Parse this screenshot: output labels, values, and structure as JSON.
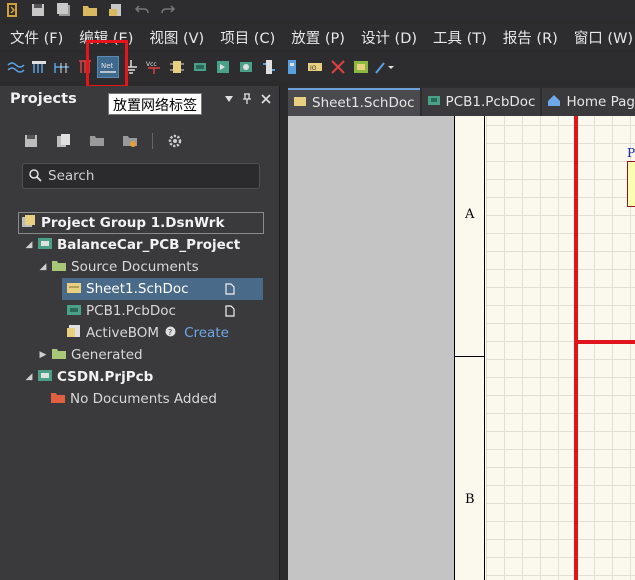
{
  "menu": [
    "文件 (F)",
    "编辑 (E)",
    "视图 (V)",
    "项目 (C)",
    "放置 (P)",
    "设计 (D)",
    "工具 (T)",
    "报告 (R)",
    "窗口 (W)"
  ],
  "tooltip": "放置网络标签",
  "panel": {
    "title": "Projects",
    "search_placeholder": "Search"
  },
  "tree": {
    "group": "Project Group 1.DsnWrk",
    "project1": "BalanceCar_PCB_Project",
    "source_folder": "Source Documents",
    "sheet": "Sheet1.SchDoc",
    "pcb": "PCB1.PcbDoc",
    "bom": "ActiveBOM",
    "bom_action": "Create",
    "generated": "Generated",
    "project2": "CSDN.PrjPcb",
    "no_docs": "No Documents Added"
  },
  "tabs": [
    "Sheet1.SchDoc",
    "PCB1.PcbDoc",
    "Home Page"
  ],
  "sheet": {
    "zone_a": "A",
    "zone_b": "B",
    "component_label": "P"
  },
  "colors": {
    "highlight": "#e8141c",
    "wire": "#e0141c",
    "selection": "#4a6a8a"
  }
}
